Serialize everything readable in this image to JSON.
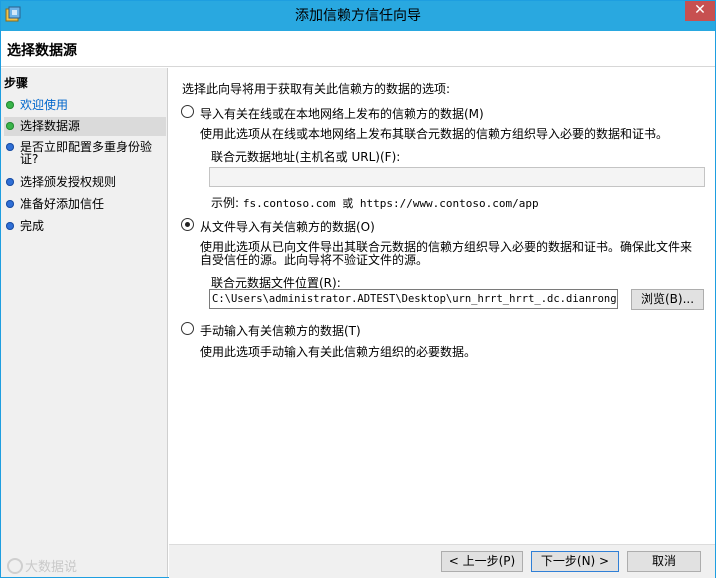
{
  "window": {
    "title": "添加信赖方信任向导",
    "close_glyph": "✕"
  },
  "header": {
    "title": "选择数据源"
  },
  "sidebar": {
    "heading": "步骤",
    "items": [
      {
        "label": "欢迎使用",
        "status": "done",
        "link": true
      },
      {
        "label": "选择数据源",
        "status": "current",
        "link": false
      },
      {
        "label": "是否立即配置多重身份验证?",
        "status": "pending",
        "link": false
      },
      {
        "label": "选择颁发授权规则",
        "status": "pending",
        "link": false
      },
      {
        "label": "准备好添加信任",
        "status": "pending",
        "link": false
      },
      {
        "label": "完成",
        "status": "pending",
        "link": false
      }
    ],
    "item2_line1": "是否立即配置多重身份验",
    "item2_line2": "证?"
  },
  "watermark": "大数据说",
  "main": {
    "intro": "选择此向导将用于获取有关此信赖方的数据的选项:",
    "option_online": {
      "label": "导入有关在线或在本地网络上发布的信赖方的数据(M)",
      "description": "使用此选项从在线或本地网络上发布其联合元数据的信赖方组织导入必要的数据和证书。",
      "field_label": "联合元数据地址(主机名或 URL)(F):",
      "field_value": "",
      "example_prefix": "示例:",
      "example_value": "fs.contoso.com 或 https://www.contoso.com/app",
      "checked": false
    },
    "option_file": {
      "label": "从文件导入有关信赖方的数据(O)",
      "description_line1": "使用此选项从已向文件导出其联合元数据的信赖方组织导入必要的数据和证书。确保此文件来",
      "description_line2": "自受信任的源。此向导将不验证文件的源。",
      "field_label": "联合元数据文件位置(R):",
      "field_value": "C:\\Users\\administrator.ADTEST\\Desktop\\urn_hrrt_hrrt_.dc.dianrong.com",
      "browse_label": "浏览(B)...",
      "checked": true
    },
    "option_manual": {
      "label": "手动输入有关信赖方的数据(T)",
      "description": "使用此选项手动输入有关此信赖方组织的必要数据。",
      "checked": false
    }
  },
  "footer": {
    "back_label": "< 上一步(P)",
    "next_label": "下一步(N) >",
    "cancel_label": "取消"
  },
  "colors": {
    "titlebar": "#29a8e0",
    "done_dot": "#39b54a",
    "pending_dot": "#2f6fd6",
    "link": "#0066cc"
  }
}
